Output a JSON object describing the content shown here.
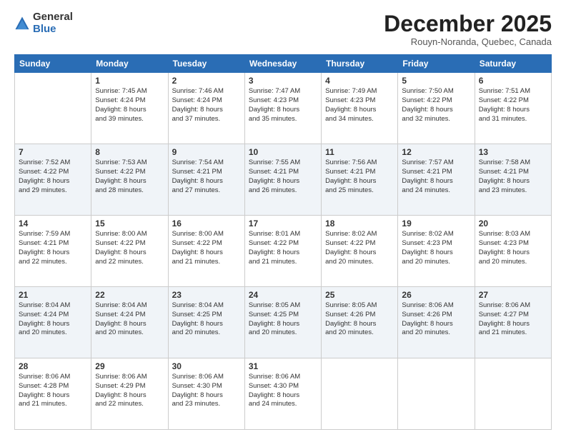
{
  "logo": {
    "general": "General",
    "blue": "Blue"
  },
  "title": "December 2025",
  "subtitle": "Rouyn-Noranda, Quebec, Canada",
  "weekdays": [
    "Sunday",
    "Monday",
    "Tuesday",
    "Wednesday",
    "Thursday",
    "Friday",
    "Saturday"
  ],
  "weeks": [
    [
      {
        "day": "",
        "info": ""
      },
      {
        "day": "1",
        "info": "Sunrise: 7:45 AM\nSunset: 4:24 PM\nDaylight: 8 hours\nand 39 minutes."
      },
      {
        "day": "2",
        "info": "Sunrise: 7:46 AM\nSunset: 4:24 PM\nDaylight: 8 hours\nand 37 minutes."
      },
      {
        "day": "3",
        "info": "Sunrise: 7:47 AM\nSunset: 4:23 PM\nDaylight: 8 hours\nand 35 minutes."
      },
      {
        "day": "4",
        "info": "Sunrise: 7:49 AM\nSunset: 4:23 PM\nDaylight: 8 hours\nand 34 minutes."
      },
      {
        "day": "5",
        "info": "Sunrise: 7:50 AM\nSunset: 4:22 PM\nDaylight: 8 hours\nand 32 minutes."
      },
      {
        "day": "6",
        "info": "Sunrise: 7:51 AM\nSunset: 4:22 PM\nDaylight: 8 hours\nand 31 minutes."
      }
    ],
    [
      {
        "day": "7",
        "info": "Sunrise: 7:52 AM\nSunset: 4:22 PM\nDaylight: 8 hours\nand 29 minutes."
      },
      {
        "day": "8",
        "info": "Sunrise: 7:53 AM\nSunset: 4:22 PM\nDaylight: 8 hours\nand 28 minutes."
      },
      {
        "day": "9",
        "info": "Sunrise: 7:54 AM\nSunset: 4:21 PM\nDaylight: 8 hours\nand 27 minutes."
      },
      {
        "day": "10",
        "info": "Sunrise: 7:55 AM\nSunset: 4:21 PM\nDaylight: 8 hours\nand 26 minutes."
      },
      {
        "day": "11",
        "info": "Sunrise: 7:56 AM\nSunset: 4:21 PM\nDaylight: 8 hours\nand 25 minutes."
      },
      {
        "day": "12",
        "info": "Sunrise: 7:57 AM\nSunset: 4:21 PM\nDaylight: 8 hours\nand 24 minutes."
      },
      {
        "day": "13",
        "info": "Sunrise: 7:58 AM\nSunset: 4:21 PM\nDaylight: 8 hours\nand 23 minutes."
      }
    ],
    [
      {
        "day": "14",
        "info": "Sunrise: 7:59 AM\nSunset: 4:21 PM\nDaylight: 8 hours\nand 22 minutes."
      },
      {
        "day": "15",
        "info": "Sunrise: 8:00 AM\nSunset: 4:22 PM\nDaylight: 8 hours\nand 22 minutes."
      },
      {
        "day": "16",
        "info": "Sunrise: 8:00 AM\nSunset: 4:22 PM\nDaylight: 8 hours\nand 21 minutes."
      },
      {
        "day": "17",
        "info": "Sunrise: 8:01 AM\nSunset: 4:22 PM\nDaylight: 8 hours\nand 21 minutes."
      },
      {
        "day": "18",
        "info": "Sunrise: 8:02 AM\nSunset: 4:22 PM\nDaylight: 8 hours\nand 20 minutes."
      },
      {
        "day": "19",
        "info": "Sunrise: 8:02 AM\nSunset: 4:23 PM\nDaylight: 8 hours\nand 20 minutes."
      },
      {
        "day": "20",
        "info": "Sunrise: 8:03 AM\nSunset: 4:23 PM\nDaylight: 8 hours\nand 20 minutes."
      }
    ],
    [
      {
        "day": "21",
        "info": "Sunrise: 8:04 AM\nSunset: 4:24 PM\nDaylight: 8 hours\nand 20 minutes."
      },
      {
        "day": "22",
        "info": "Sunrise: 8:04 AM\nSunset: 4:24 PM\nDaylight: 8 hours\nand 20 minutes."
      },
      {
        "day": "23",
        "info": "Sunrise: 8:04 AM\nSunset: 4:25 PM\nDaylight: 8 hours\nand 20 minutes."
      },
      {
        "day": "24",
        "info": "Sunrise: 8:05 AM\nSunset: 4:25 PM\nDaylight: 8 hours\nand 20 minutes."
      },
      {
        "day": "25",
        "info": "Sunrise: 8:05 AM\nSunset: 4:26 PM\nDaylight: 8 hours\nand 20 minutes."
      },
      {
        "day": "26",
        "info": "Sunrise: 8:06 AM\nSunset: 4:26 PM\nDaylight: 8 hours\nand 20 minutes."
      },
      {
        "day": "27",
        "info": "Sunrise: 8:06 AM\nSunset: 4:27 PM\nDaylight: 8 hours\nand 21 minutes."
      }
    ],
    [
      {
        "day": "28",
        "info": "Sunrise: 8:06 AM\nSunset: 4:28 PM\nDaylight: 8 hours\nand 21 minutes."
      },
      {
        "day": "29",
        "info": "Sunrise: 8:06 AM\nSunset: 4:29 PM\nDaylight: 8 hours\nand 22 minutes."
      },
      {
        "day": "30",
        "info": "Sunrise: 8:06 AM\nSunset: 4:30 PM\nDaylight: 8 hours\nand 23 minutes."
      },
      {
        "day": "31",
        "info": "Sunrise: 8:06 AM\nSunset: 4:30 PM\nDaylight: 8 hours\nand 24 minutes."
      },
      {
        "day": "",
        "info": ""
      },
      {
        "day": "",
        "info": ""
      },
      {
        "day": "",
        "info": ""
      }
    ]
  ]
}
